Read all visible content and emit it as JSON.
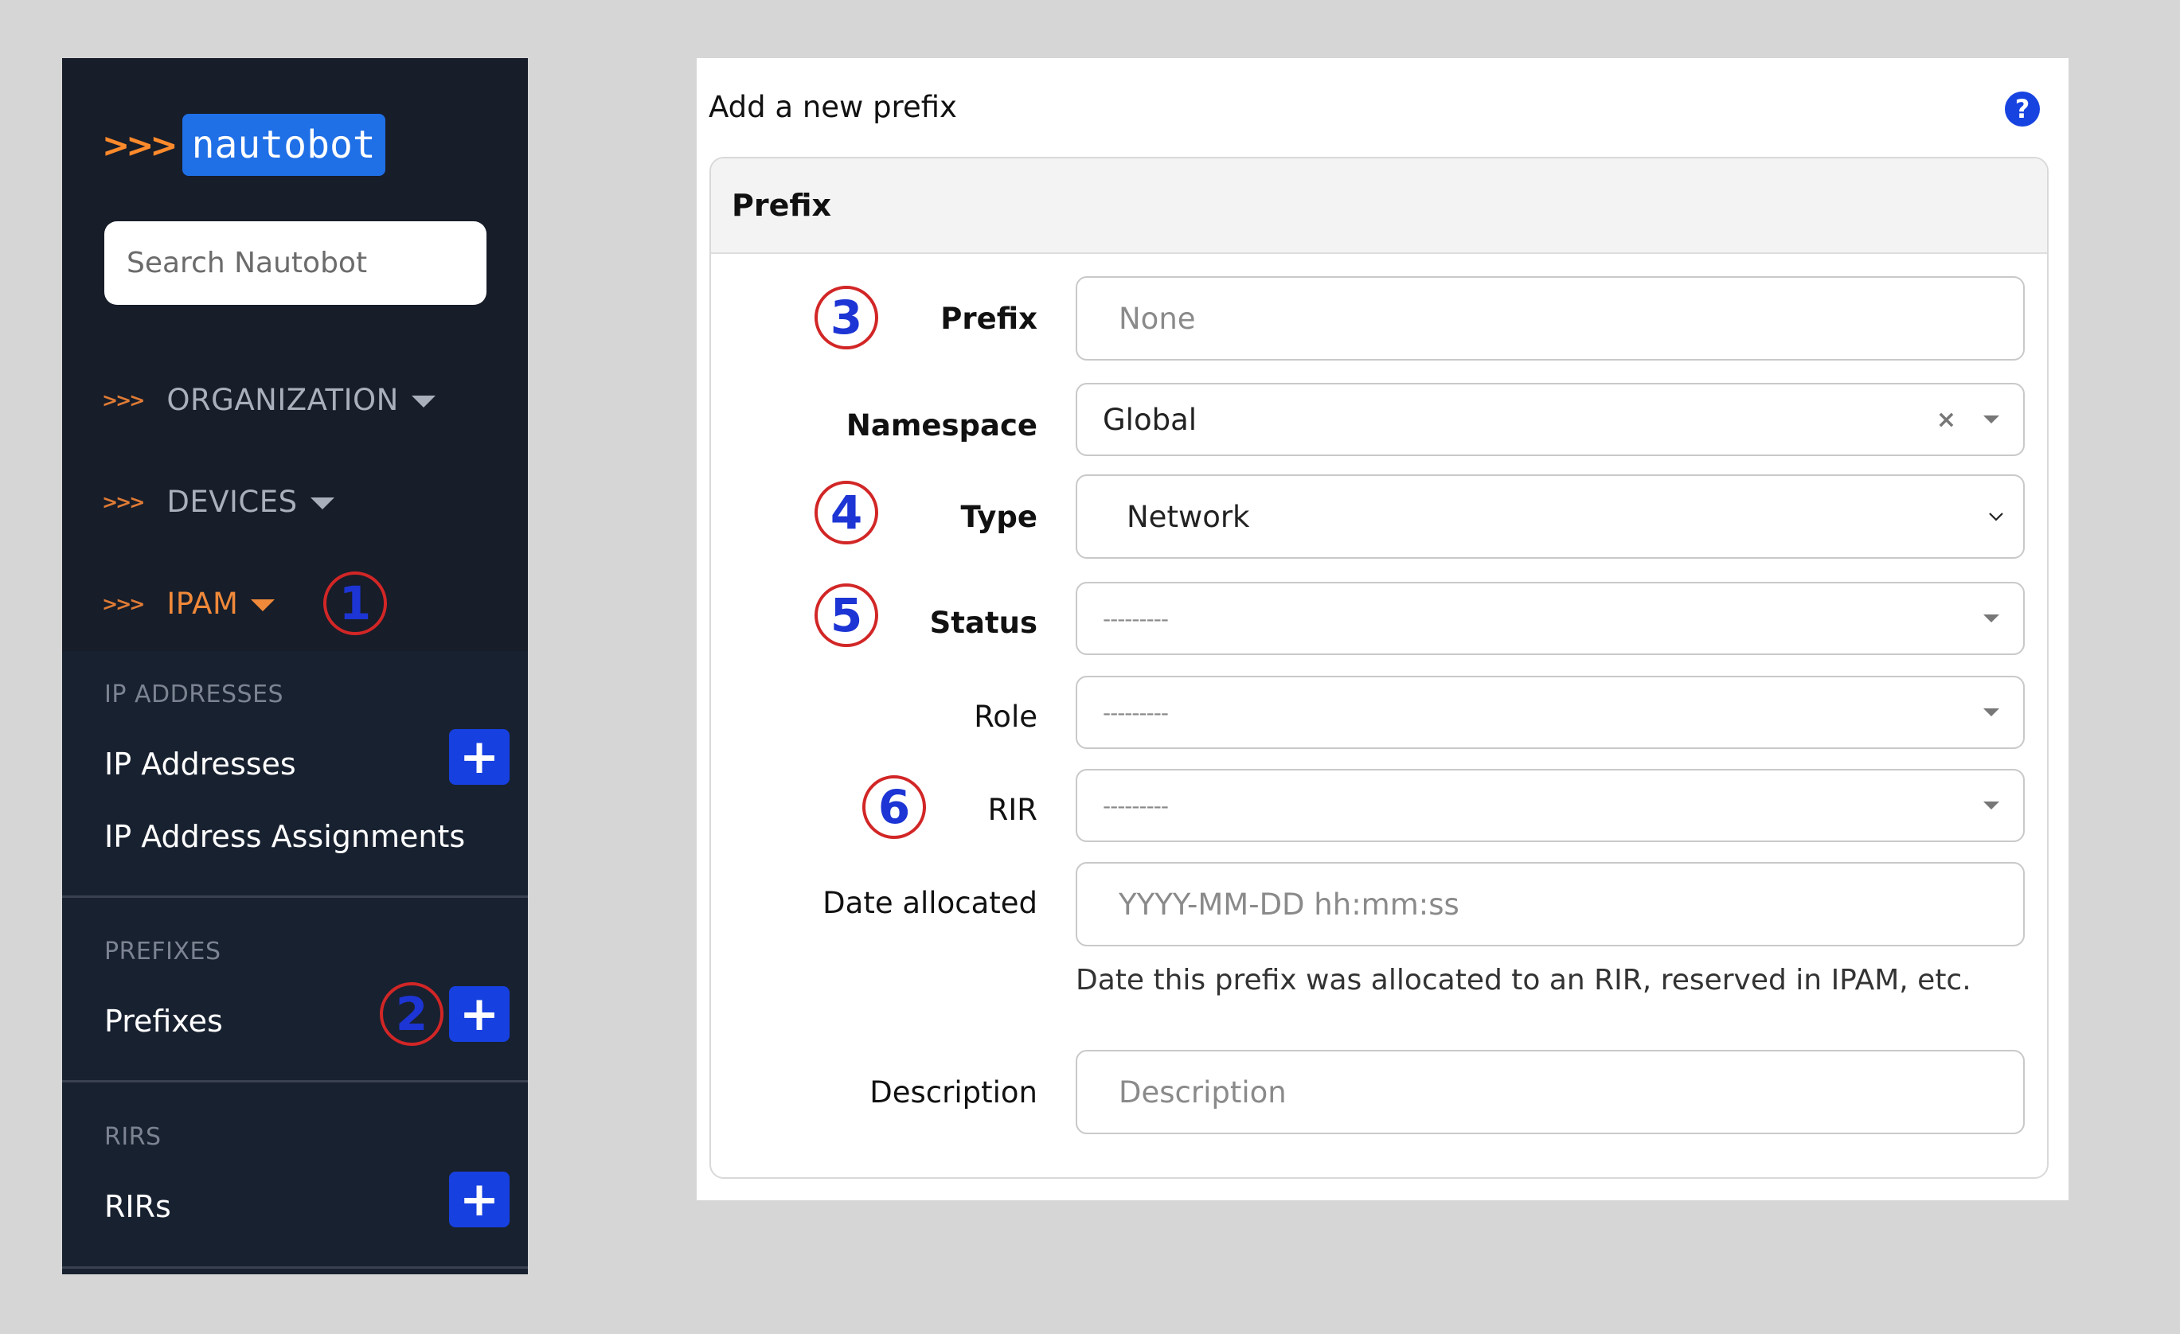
{
  "sidebar": {
    "brand_chevrons": ">>>",
    "brand_name": "nautobot",
    "search": {
      "placeholder": "Search Nautobot"
    },
    "nav": [
      {
        "chevrons": ">>>",
        "label": "ORGANIZATION"
      },
      {
        "chevrons": ">>>",
        "label": "DEVICES"
      },
      {
        "chevrons": ">>>",
        "label": "IPAM",
        "active": true
      }
    ],
    "groups": {
      "ip_addresses": {
        "header": "IP ADDRESSES",
        "items": [
          "IP Addresses",
          "IP Address Assignments"
        ]
      },
      "prefixes": {
        "header": "PREFIXES",
        "items": [
          "Prefixes"
        ]
      },
      "rirs": {
        "header": "RIRS",
        "items": [
          "RIRs"
        ]
      }
    },
    "add_label": "+"
  },
  "callouts": [
    "1",
    "2",
    "3",
    "4",
    "5",
    "6"
  ],
  "form": {
    "title": "Add a new prefix",
    "help_icon": "?",
    "card_header": "Prefix",
    "fields": {
      "prefix": {
        "label": "Prefix",
        "placeholder": "None"
      },
      "namespace": {
        "label": "Namespace",
        "value": "Global",
        "clear": "×"
      },
      "type": {
        "label": "Type",
        "value": "Network"
      },
      "status": {
        "label": "Status",
        "value": "---------"
      },
      "role": {
        "label": "Role",
        "value": "---------"
      },
      "rir": {
        "label": "RIR",
        "value": "---------"
      },
      "date_allocated": {
        "label": "Date allocated",
        "placeholder": "YYYY-MM-DD hh:mm:ss",
        "help": "Date this prefix was allocated to an RIR, reserved in IPAM, etc."
      },
      "description": {
        "label": "Description",
        "placeholder": "Description"
      }
    }
  },
  "colors": {
    "sidebar_bg": "#171d29",
    "accent_orange": "#f0893a",
    "brand_blue": "#1f6fe6",
    "add_button": "#1740e0",
    "callout_ring": "#d22626",
    "callout_number": "#1d35d4"
  }
}
